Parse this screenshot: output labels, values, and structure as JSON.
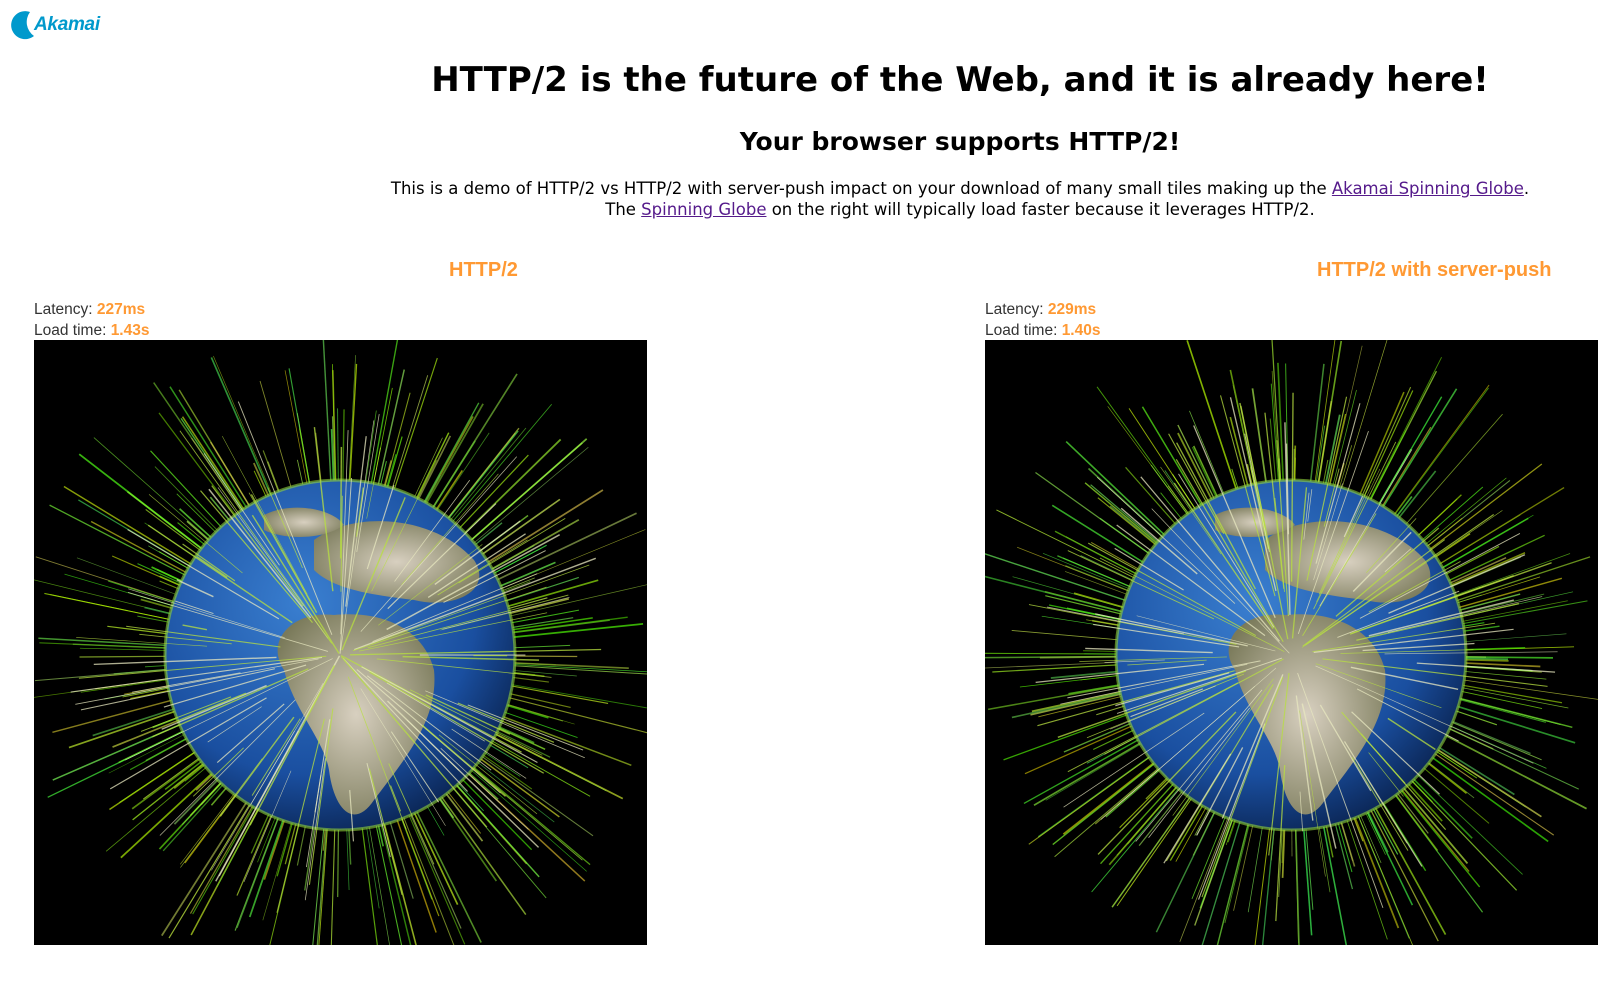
{
  "logo": {
    "text": "Akamai",
    "brand_color": "#0099cc"
  },
  "header": {
    "title": "HTTP/2 is the future of the Web, and it is already here!",
    "subtitle": "Your browser supports HTTP/2!"
  },
  "intro": {
    "line1_prefix": "This is a demo of HTTP/2 vs HTTP/2 with server-push impact on your download of many small tiles making up the ",
    "line1_link": "Akamai Spinning Globe",
    "line1_suffix": ".",
    "line2_prefix": "The ",
    "line2_link": "Spinning Globe",
    "line2_suffix": " on the right will typically load faster because it leverages HTTP/2."
  },
  "panels": [
    {
      "title": "HTTP/2",
      "latency_label": "Latency: ",
      "latency_value": "227ms",
      "load_label": "Load time: ",
      "load_value": "1.43s"
    },
    {
      "title": "HTTP/2 with server-push",
      "latency_label": "Latency: ",
      "latency_value": "229ms",
      "load_label": "Load time: ",
      "load_value": "1.40s"
    }
  ],
  "colors": {
    "accent": "#ff9933",
    "link": "#551a8b"
  }
}
